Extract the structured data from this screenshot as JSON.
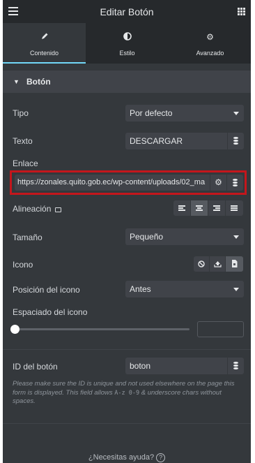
{
  "header": {
    "title": "Editar Botón"
  },
  "tabs": [
    {
      "label": "Contenido",
      "icon": "pencil-icon",
      "active": true
    },
    {
      "label": "Estilo",
      "icon": "contrast-icon",
      "active": false
    },
    {
      "label": "Avanzado",
      "icon": "gear-icon",
      "active": false
    }
  ],
  "section": {
    "title": "Botón"
  },
  "fields": {
    "tipo": {
      "label": "Tipo",
      "value": "Por defecto"
    },
    "texto": {
      "label": "Texto",
      "value": "DESCARGAR"
    },
    "enlace": {
      "label": "Enlace",
      "value": "https://zonales.quito.gob.ec/wp-content/uploads/02_ma"
    },
    "alineacion": {
      "label": "Alineación",
      "options": [
        "left",
        "center",
        "right",
        "justify"
      ],
      "selected": "center"
    },
    "tamano": {
      "label": "Tamaño",
      "value": "Pequeño"
    },
    "icono": {
      "label": "Icono",
      "options": [
        "none",
        "upload",
        "library"
      ],
      "selected": "library"
    },
    "posicion": {
      "label": "Posición del icono",
      "value": "Antes"
    },
    "espaciado": {
      "label": "Espaciado del icono",
      "value": 0
    },
    "id_boton": {
      "label": "ID del botón",
      "value": "boton",
      "help_part1": "Please make sure the ID is unique and not used elsewhere on the page this form is displayed. This field allows ",
      "help_code": "A-z 0-9",
      "help_part2": " & underscore chars without spaces."
    }
  },
  "footer": {
    "help_label": "¿Necesitas ayuda?",
    "help_icon_glyph": "?"
  },
  "colors": {
    "panel": "#34383c",
    "header": "#26292c",
    "accent": "#71d7f7",
    "highlight": "#c4161c"
  }
}
